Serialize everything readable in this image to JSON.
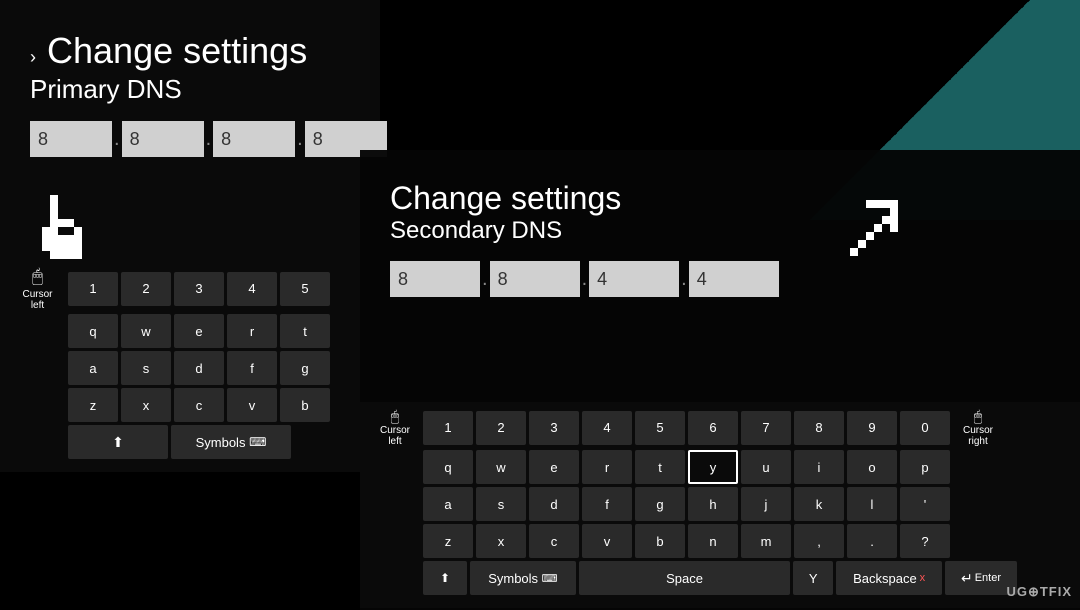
{
  "primary": {
    "breadcrumb": "›",
    "title": "Change settings",
    "subtitle": "Primary DNS",
    "dns_fields": [
      "8",
      "8",
      "8",
      "8"
    ]
  },
  "secondary": {
    "title": "Change settings",
    "subtitle": "Secondary DNS",
    "dns_fields": [
      "8",
      "8",
      "4",
      "4"
    ]
  },
  "keyboard_primary": {
    "cursor_left_label": "Cursor\nleft",
    "caps_label": "Caps",
    "symbols_label": "Symbols",
    "rows": {
      "numbers": [
        "1",
        "2",
        "3",
        "4",
        "5"
      ],
      "row1": [
        "q",
        "w",
        "e",
        "r",
        "t"
      ],
      "row2": [
        "a",
        "s",
        "d",
        "f",
        "g"
      ],
      "row3": [
        "z",
        "x",
        "c",
        "v",
        "b"
      ]
    }
  },
  "keyboard_secondary": {
    "cursor_left_label": "Cursor\nleft",
    "cursor_right_label": "Cursor\nright",
    "caps_label": "Caps",
    "symbols_label": "Symbols",
    "space_label": "Space",
    "backspace_label": "Backspace",
    "enter_label": "Enter",
    "rows": {
      "numbers": [
        "1",
        "2",
        "3",
        "4",
        "5",
        "6",
        "7",
        "8",
        "9",
        "0"
      ],
      "row1": [
        "q",
        "w",
        "e",
        "r",
        "t",
        "y",
        "u",
        "i",
        "o",
        "p"
      ],
      "row2": [
        "a",
        "s",
        "d",
        "f",
        "g",
        "h",
        "j",
        "k",
        "l",
        "'"
      ],
      "row3": [
        "z",
        "x",
        "c",
        "v",
        "b",
        "n",
        "m",
        ",",
        ".",
        "?"
      ]
    },
    "highlighted_key": "y"
  },
  "logo": "UG⊕TFIX"
}
